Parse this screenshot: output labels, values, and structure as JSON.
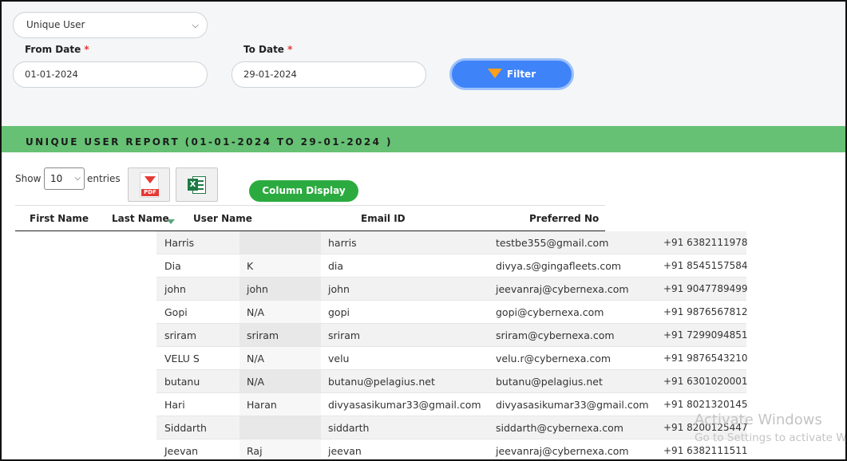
{
  "filters": {
    "report_type": "Unique User",
    "from_date_label": "From Date",
    "from_date_value": "01-01-2024",
    "to_date_label": "To Date",
    "to_date_value": "29-01-2024",
    "required_mark": "*",
    "filter_button": "Filter"
  },
  "report": {
    "title": "UNIQUE USER REPORT (01-01-2024 TO 29-01-2024 )",
    "show_label": "Show",
    "entries_value": "10",
    "entries_label": "entries",
    "pdf_tag": "PDF",
    "excel_tag": "X",
    "column_display_button": "Column Display"
  },
  "table": {
    "headers": [
      "First Name",
      "Last Name",
      "User Name",
      "Email ID",
      "Preferred No"
    ],
    "rows": [
      {
        "first": "Harris",
        "last": "",
        "user": "harris",
        "email": "testbe355@gmail.com",
        "phone": "+91 6382111978"
      },
      {
        "first": "Dia",
        "last": "K",
        "user": "dia",
        "email": "divya.s@gingafleets.com",
        "phone": "+91 8545157584"
      },
      {
        "first": "john",
        "last": "john",
        "user": "john",
        "email": "jeevanraj@cybernexa.com",
        "phone": "+91 9047789499"
      },
      {
        "first": "Gopi",
        "last": "N/A",
        "user": "gopi",
        "email": "gopi@cybernexa.com",
        "phone": "+91 9876567812"
      },
      {
        "first": "sriram",
        "last": "sriram",
        "user": "sriram",
        "email": "sriram@cybernexa.com",
        "phone": "+91 7299094851"
      },
      {
        "first": "VELU S",
        "last": "N/A",
        "user": "velu",
        "email": "velu.r@cybernexa.com",
        "phone": "+91 9876543210"
      },
      {
        "first": "butanu",
        "last": "N/A",
        "user": "butanu@pelagius.net",
        "email": "butanu@pelagius.net",
        "phone": "+91 6301020001"
      },
      {
        "first": "Hari",
        "last": "Haran",
        "user": "divyasasikumar33@gmail.com",
        "email": "divyasasikumar33@gmail.com",
        "phone": "+91 8021320145"
      },
      {
        "first": "Siddarth",
        "last": "",
        "user": "siddarth",
        "email": "siddarth@cybernexa.com",
        "phone": "+91 8200125447"
      },
      {
        "first": "Jeevan",
        "last": "Raj",
        "user": "jeevan",
        "email": "jeevanraj@cybernexa.com",
        "phone": "+91 6382111511"
      }
    ]
  },
  "watermark": {
    "line1": "Activate Windows",
    "line2": "Go to Settings to activate Windows."
  },
  "colors": {
    "banner": "#66c174",
    "filter_button": "#3f83f8",
    "column_display": "#2bab3f",
    "required": "#e53935"
  }
}
